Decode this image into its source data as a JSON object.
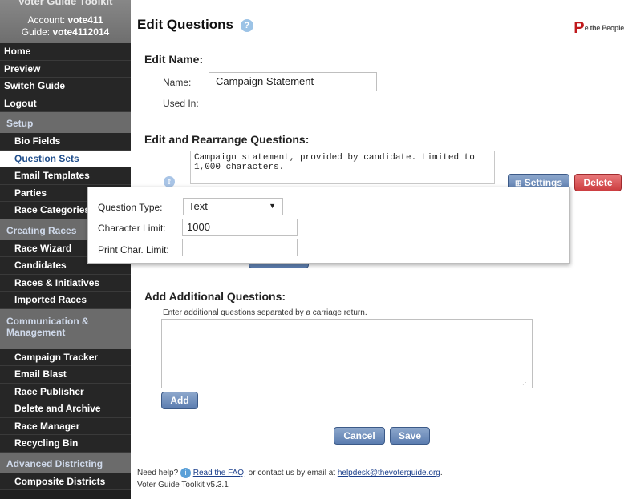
{
  "sidebar": {
    "brand_title": "Voter Guide Toolkit",
    "account_label": "Account:",
    "account_value": "vote411",
    "guide_label": "Guide:",
    "guide_value": "vote4112014",
    "top_items": [
      {
        "label": "Home"
      },
      {
        "label": "Preview"
      },
      {
        "label": "Switch Guide"
      },
      {
        "label": "Logout"
      }
    ],
    "setup_head": "Setup",
    "setup_items": [
      {
        "label": "Bio Fields"
      },
      {
        "label": "Question Sets"
      },
      {
        "label": "Email Templates"
      },
      {
        "label": "Parties"
      },
      {
        "label": "Race Categories"
      }
    ],
    "races_head": "Creating Races",
    "races_items": [
      {
        "label": "Race Wizard"
      },
      {
        "label": "Candidates"
      },
      {
        "label": "Races & Initiatives"
      },
      {
        "label": "Imported Races"
      }
    ],
    "comm_head": "Communication & Management",
    "comm_items": [
      {
        "label": "Campaign Tracker"
      },
      {
        "label": "Email Blast"
      },
      {
        "label": "Race Publisher"
      },
      {
        "label": "Delete and Archive"
      },
      {
        "label": "Race Manager"
      },
      {
        "label": "Recycling Bin"
      }
    ],
    "adv_head": "Advanced Districting",
    "adv_items": [
      {
        "label": "Composite Districts"
      }
    ]
  },
  "header": {
    "title": "Edit Questions",
    "help_glyph": "?",
    "logo_glyph": "P",
    "logo_text": "e the People"
  },
  "edit_name": {
    "heading": "Edit Name:",
    "name_label": "Name:",
    "name_value": "Campaign Statement",
    "used_in_label": "Used In:"
  },
  "rearrange": {
    "heading": "Edit and Rearrange Questions:",
    "question_text": "Campaign statement, provided by candidate.  Limited to 1,000 characters.",
    "settings_label": "Settings",
    "delete_label": "Delete"
  },
  "settings_popup": {
    "type_label": "Question Type:",
    "type_value": "Text",
    "char_limit_label": "Character Limit:",
    "char_limit_value": "1000",
    "print_limit_label": "Print Char. Limit:",
    "print_limit_value": ""
  },
  "additional": {
    "heading": "Add Additional Questions:",
    "instructions": "Enter additional questions separated by a carriage return.",
    "add_label": "Add"
  },
  "actions": {
    "cancel_label": "Cancel",
    "save_label": "Save"
  },
  "footer": {
    "need_help": "Need help?",
    "faq_link": "Read the FAQ",
    "contact_text": ", or contact us by email at",
    "email_link": "helpdesk@thevoterguide.org",
    "version": "Voter Guide Toolkit v5.3.1"
  }
}
